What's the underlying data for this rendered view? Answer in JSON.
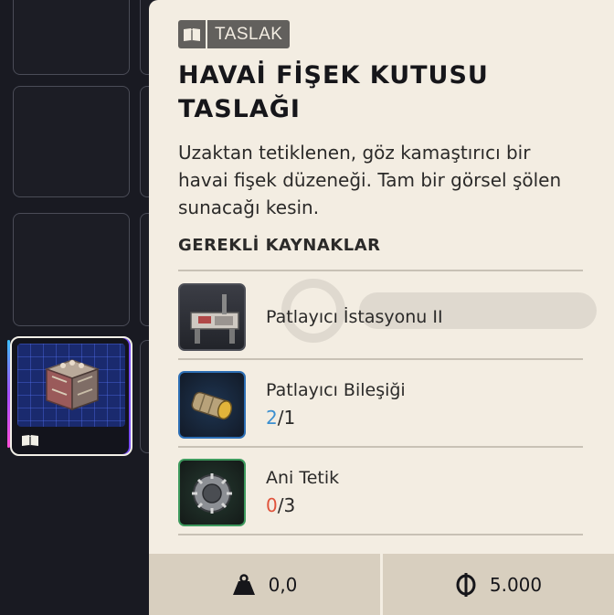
{
  "tooltip": {
    "tag_label": "TASLAK",
    "title": "HAVAİ FİŞEK KUTUSU TASLAĞI",
    "description": "Uzaktan tetiklenen, göz kamaştırıcı bir havai fişek düzeneği. Tam bir görsel şölen sunacağı kesin.",
    "section_title": "GEREKLİ KAYNAKLAR",
    "resources": [
      {
        "name": "Patlayıcı İstasyonu II",
        "icon": "workstation-icon",
        "rarity_color": "#4d4f57"
      },
      {
        "name": "Patlayıcı Bileşiği",
        "have": "2",
        "need": "/1",
        "icon": "explosive-compound-icon",
        "rarity_color": "#2d6fb5",
        "have_color": "#3b8fd0"
      },
      {
        "name": "Ani Tetik",
        "have": "0",
        "need": "/3",
        "icon": "trigger-icon",
        "rarity_color": "#3e9a5e",
        "have_color": "#e0533b"
      }
    ],
    "footer": {
      "weight": "0,0",
      "weight_icon": "weight-icon",
      "price": "5.000",
      "price_icon": "coin-icon"
    }
  },
  "inventory": {
    "selected_item_icon": "firework-crate-icon",
    "selected_item_badge_icon": "blueprint-icon"
  },
  "colors": {
    "panel_bg": "#f3ede2",
    "footer_bg": "#d8cfbf",
    "tag_bg": "#62605d",
    "page_bg": "#191a22"
  }
}
